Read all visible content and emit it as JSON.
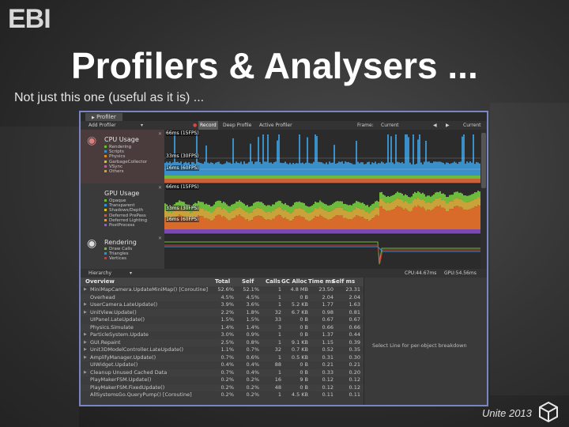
{
  "slide": {
    "title": "Profilers & Analysers ...",
    "subtitle": "Not just this one (useful as it is) ...",
    "footer": "Unite 2013",
    "logo_text": "EBI"
  },
  "profiler": {
    "tab_label": "Profiler",
    "toolbar": {
      "add_profiler": "Add Profiler",
      "record": "Record",
      "deep_profile": "Deep Profile",
      "active_profiler": "Active Profiler",
      "frame": "Frame:",
      "current_label": "Current",
      "current_button": "Current"
    },
    "sections": [
      {
        "title": "CPU Usage",
        "legend": [
          {
            "label": "Rendering",
            "color": "#6dbb3a"
          },
          {
            "label": "Scripts",
            "color": "#3b8fc9"
          },
          {
            "label": "Physics",
            "color": "#d88a2a"
          },
          {
            "label": "GarbageCollector",
            "color": "#c9c23a"
          },
          {
            "label": "VSync",
            "color": "#c95a9a"
          },
          {
            "label": "Others",
            "color": "#c9a23a"
          }
        ],
        "lines": [
          "66ms (15FPS)",
          "33ms (30FPS)",
          "16ms (60FPS)"
        ]
      },
      {
        "title": "GPU Usage",
        "legend": [
          {
            "label": "Opaque",
            "color": "#6dbb3a"
          },
          {
            "label": "Transparent",
            "color": "#3b8fc9"
          },
          {
            "label": "Shadows/Depth",
            "color": "#d8c02a"
          },
          {
            "label": "Deferred PrePass",
            "color": "#c95a3a"
          },
          {
            "label": "Deferred Lighting",
            "color": "#e0a030"
          },
          {
            "label": "PostProcess",
            "color": "#9a5ac9"
          }
        ],
        "lines": [
          "66ms (15FPS)",
          "33ms (30FPS)",
          "16ms (60FPS)"
        ]
      },
      {
        "title": "Rendering",
        "legend": [
          {
            "label": "Draw Calls",
            "color": "#6dbb3a"
          },
          {
            "label": "Triangles",
            "color": "#3b8fc9"
          },
          {
            "label": "Vertices",
            "color": "#c93a3a"
          }
        ],
        "lines": []
      }
    ],
    "hierarchy": {
      "label": "Hierarchy",
      "cpu": "CPU:44.67ms",
      "gpu": "GPU:54.56ms",
      "columns": [
        "Overview",
        "Total",
        "Self",
        "Calls",
        "GC Alloc",
        "Time ms",
        "Self ms"
      ],
      "rows": [
        {
          "name": "MiniMapCamera.UpdateMiniMap() [Coroutine]",
          "arrow": true,
          "total": "52.6%",
          "self": "52.1%",
          "calls": "1",
          "gc": "4.8 MB",
          "time": "23.50",
          "selfms": "23.31"
        },
        {
          "name": "Overhead",
          "arrow": false,
          "total": "4.5%",
          "self": "4.5%",
          "calls": "1",
          "gc": "0 B",
          "time": "2.04",
          "selfms": "2.04"
        },
        {
          "name": "UserCamera.LateUpdate()",
          "arrow": true,
          "total": "3.9%",
          "self": "3.6%",
          "calls": "1",
          "gc": "5.2 KB",
          "time": "1.77",
          "selfms": "1.63"
        },
        {
          "name": "UnitView.Update()",
          "arrow": true,
          "total": "2.2%",
          "self": "1.8%",
          "calls": "32",
          "gc": "6.7 KB",
          "time": "0.98",
          "selfms": "0.81"
        },
        {
          "name": "UIPanel.LateUpdate()",
          "arrow": false,
          "total": "1.5%",
          "self": "1.5%",
          "calls": "33",
          "gc": "0 B",
          "time": "0.67",
          "selfms": "0.67"
        },
        {
          "name": "Physics.Simulate",
          "arrow": false,
          "total": "1.4%",
          "self": "1.4%",
          "calls": "3",
          "gc": "0 B",
          "time": "0.66",
          "selfms": "0.66"
        },
        {
          "name": "ParticleSystem.Update",
          "arrow": true,
          "total": "3.0%",
          "self": "0.9%",
          "calls": "1",
          "gc": "0 B",
          "time": "1.37",
          "selfms": "0.44"
        },
        {
          "name": "GUI.Repaint",
          "arrow": true,
          "total": "2.5%",
          "self": "0.8%",
          "calls": "1",
          "gc": "9.1 KB",
          "time": "1.15",
          "selfms": "0.39"
        },
        {
          "name": "Unit3DModelController.LateUpdate()",
          "arrow": true,
          "total": "1.1%",
          "self": "0.7%",
          "calls": "32",
          "gc": "0.7 KB",
          "time": "0.52",
          "selfms": "0.35"
        },
        {
          "name": "AmplifyManager.Update()",
          "arrow": true,
          "total": "0.7%",
          "self": "0.6%",
          "calls": "1",
          "gc": "0.5 KB",
          "time": "0.31",
          "selfms": "0.30"
        },
        {
          "name": "UIWidget.Update()",
          "arrow": false,
          "total": "0.4%",
          "self": "0.4%",
          "calls": "88",
          "gc": "0 B",
          "time": "0.21",
          "selfms": "0.21"
        },
        {
          "name": "Cleanup Unused Cached Data",
          "arrow": true,
          "total": "0.7%",
          "self": "0.4%",
          "calls": "1",
          "gc": "0 B",
          "time": "0.33",
          "selfms": "0.20"
        },
        {
          "name": "PlayMakerFSM.Update()",
          "arrow": false,
          "total": "0.2%",
          "self": "0.2%",
          "calls": "16",
          "gc": "9 B",
          "time": "0.12",
          "selfms": "0.12"
        },
        {
          "name": "PlayMakerFSM.FixedUpdate()",
          "arrow": false,
          "total": "0.2%",
          "self": "0.2%",
          "calls": "48",
          "gc": "0 B",
          "time": "0.12",
          "selfms": "0.12"
        },
        {
          "name": "AllSystemsGo.QueryPump() [Coroutine]",
          "arrow": false,
          "total": "0.2%",
          "self": "0.2%",
          "calls": "1",
          "gc": "4.5 KB",
          "time": "0.11",
          "selfms": "0.11"
        }
      ],
      "side_message": "Select Line for per-object breakdown"
    }
  }
}
